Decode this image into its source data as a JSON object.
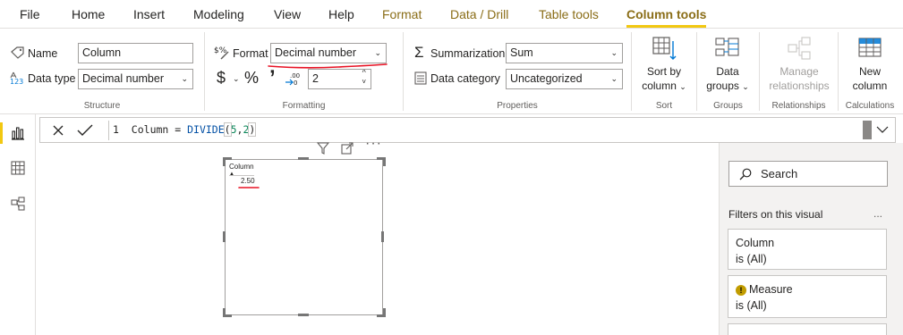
{
  "menu": {
    "tabs": [
      {
        "label": "File"
      },
      {
        "label": "Home"
      },
      {
        "label": "Insert"
      },
      {
        "label": "Modeling"
      },
      {
        "label": "View"
      },
      {
        "label": "Help"
      },
      {
        "label": "Format"
      },
      {
        "label": "Data / Drill"
      },
      {
        "label": "Table tools"
      },
      {
        "label": "Column tools"
      }
    ],
    "active_tab": "Column tools"
  },
  "ribbon": {
    "structure": {
      "name_label": "Name",
      "name_value": "Column",
      "datatype_label": "Data type",
      "datatype_value": "Decimal number",
      "group_label": "Structure"
    },
    "formatting": {
      "format_label": "Format",
      "format_value": "Decimal number",
      "currency_symbol": "$",
      "percent_symbol": "%",
      "comma_symbol": "ʼ",
      "decimals_value": "2",
      "group_label": "Formatting"
    },
    "properties": {
      "summarization_label": "Summarization",
      "summarization_value": "Sum",
      "datacategory_label": "Data category",
      "datacategory_value": "Uncategorized",
      "group_label": "Properties"
    },
    "sort": {
      "button_line1": "Sort by",
      "button_line2": "column",
      "group_label": "Sort"
    },
    "groups": {
      "button_line1": "Data",
      "button_line2": "groups",
      "group_label": "Groups"
    },
    "relationships": {
      "button_line1": "Manage",
      "button_line2": "relationships",
      "group_label": "Relationships"
    },
    "calculations": {
      "button_line1": "New",
      "button_line2": "column",
      "group_label": "Calculations"
    }
  },
  "formula_bar": {
    "line_number": "1",
    "expr_name": "Column = ",
    "expr_fn": "DIVIDE",
    "expr_open": "(",
    "expr_arg1": "5",
    "expr_comma": ",",
    "expr_arg2": "2",
    "expr_close": ")"
  },
  "visual": {
    "header": "Column",
    "value": "2.50"
  },
  "filters_pane": {
    "search_placeholder": "Search",
    "section_title": "Filters on this visual",
    "more": "...",
    "cards": [
      {
        "name": "Column",
        "state": "is (All)"
      },
      {
        "name": "Measure",
        "state": "is (All)"
      }
    ]
  },
  "colors": {
    "accent_yellow": "#f2c811",
    "context_tab_text": "#8a6d17",
    "annotation_red": "#e81123",
    "warning_icon": "#c19c00"
  }
}
